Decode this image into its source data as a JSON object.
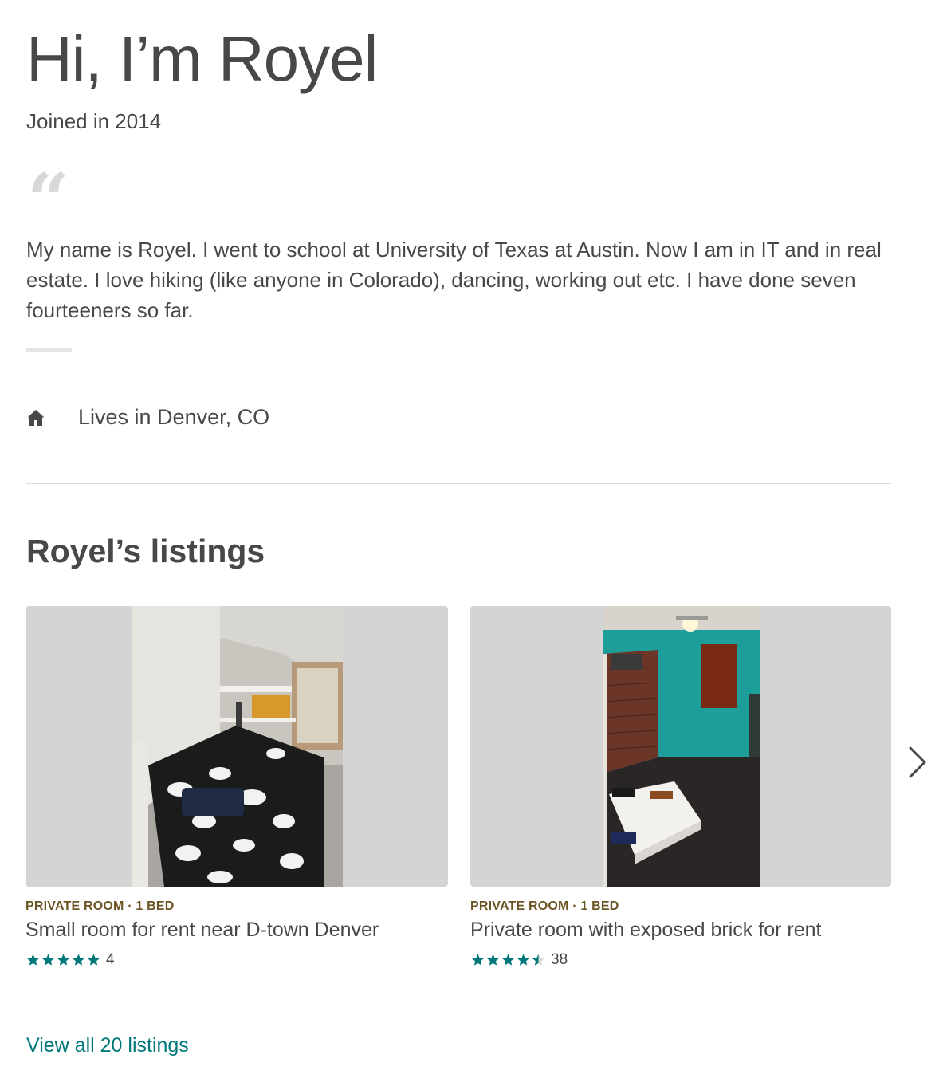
{
  "profile": {
    "greeting": "Hi, I’m Royel",
    "joined": "Joined in 2014",
    "quote_icon": "quote-icon",
    "bio": "My name is Royel. I went to school at University of Texas at Austin. Now I am in IT and in real estate. I love hiking (like anyone in Colorado), dancing, working out etc. I have done seven fourteeners so far.",
    "lives_icon": "home-icon",
    "lives_in": "Lives in Denver, CO"
  },
  "listings_section": {
    "heading": "Royel’s listings",
    "next_icon": "chevron-right-icon",
    "view_all": "View all 20 listings",
    "cards": [
      {
        "room_type": "PRIVATE ROOM · 1 BED",
        "title": "Small room for rent near D-town Denver",
        "rating_stars": 5,
        "review_count": "4",
        "photo": "bedroom with black-and-white patterned bedspread"
      },
      {
        "room_type": "PRIVATE ROOM · 1 BED",
        "title": "Private room with exposed brick for rent",
        "rating_stars": 4.5,
        "review_count": "38",
        "photo": "room with teal walls, exposed brick and a mattress"
      }
    ]
  },
  "colors": {
    "text": "#484848",
    "room_type": "#6b5424",
    "star": "#00787a",
    "link": "#00787a",
    "photo_bg": "#d4d4d4"
  }
}
